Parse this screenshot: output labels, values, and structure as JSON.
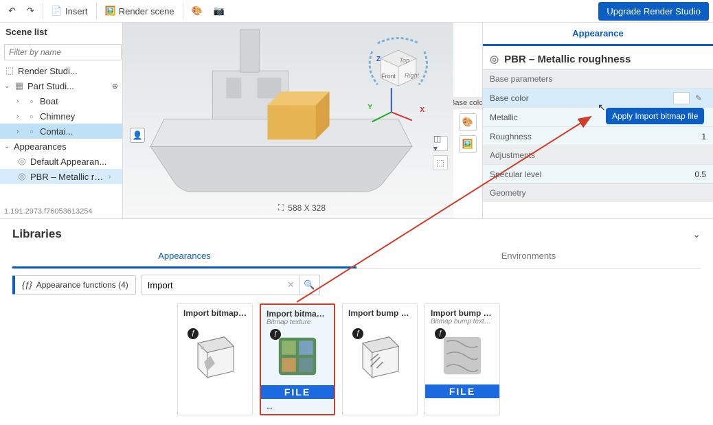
{
  "toolbar": {
    "insert": "Insert",
    "render": "Render scene",
    "upgrade": "Upgrade Render Studio"
  },
  "sidebar": {
    "header": "Scene list",
    "filter_placeholder": "Filter by name",
    "items": [
      {
        "label": "Render Studi..."
      },
      {
        "label": "Part Studi..."
      },
      {
        "label": "Boat"
      },
      {
        "label": "Chimney"
      },
      {
        "label": "Contai..."
      }
    ],
    "appearances_header": "Appearances",
    "appearances": [
      {
        "label": "Default Appearan..."
      },
      {
        "label": "PBR – Metallic ro..."
      }
    ],
    "version": "1.191.2973.f76053613254"
  },
  "viewport": {
    "cube": {
      "top": "Top",
      "front": "Front",
      "right": "Right"
    },
    "axis": {
      "x": "X",
      "y": "Y",
      "z": "Z"
    },
    "dim": "588 X 328"
  },
  "insp_chip": "Base color",
  "inspector": {
    "tab": "Appearance",
    "title": "PBR – Metallic roughness",
    "sections": {
      "base": "Base parameters",
      "adj": "Adjustments",
      "geo": "Geometry"
    },
    "props": {
      "base_color": "Base color",
      "metallic": "Metallic",
      "roughness": "Roughness",
      "roughness_val": "1",
      "specular": "Specular level",
      "specular_val": "0.5"
    }
  },
  "tooltip": "Apply Import bitmap file",
  "lib": {
    "title": "Libraries",
    "tabs": {
      "app": "Appearances",
      "env": "Environments"
    },
    "func": "Appearance functions (4)",
    "func_icon": "{ƒ}",
    "search": "Import",
    "cards": [
      {
        "title": "Import bitmap fi...",
        "sub": ""
      },
      {
        "title": "Import bitmap fi...",
        "sub": "Bitmap texture"
      },
      {
        "title": "Import bump m...",
        "sub": ""
      },
      {
        "title": "Import bump m...",
        "sub": "Bitmap bump texture"
      }
    ],
    "file_label": "FILE"
  }
}
